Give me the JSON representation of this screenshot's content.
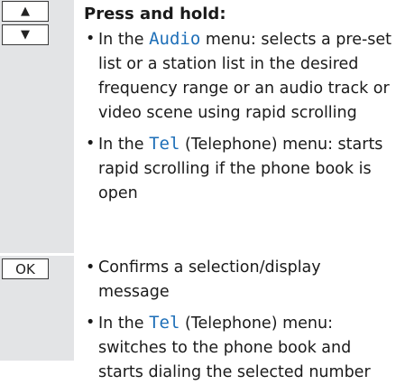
{
  "section1": {
    "keys": [
      {
        "icon": "triangle-up-icon",
        "glyph": "▲"
      },
      {
        "icon": "triangle-down-icon",
        "glyph": "▼"
      }
    ],
    "heading": "Press and hold:",
    "bullets": [
      {
        "pre": "In the ",
        "keyword": "Audio",
        "post": " menu: selects a pre-set list or a station list in the desired frequency range or an audio track or video scene using rapid scrolling"
      },
      {
        "pre": "In the ",
        "keyword": "Tel",
        "post": " (Telephone) menu: starts rapid scrolling if the phone book is open"
      }
    ]
  },
  "section2": {
    "key": {
      "icon": "ok-key-icon",
      "label": "OK"
    },
    "bullets": [
      {
        "text": "Confirms a selection/display message"
      },
      {
        "pre": "In the ",
        "keyword": "Tel",
        "post": " (Telephone) menu: switches to the phone book and starts dialing the selected number"
      }
    ]
  },
  "colors": {
    "key_column": "#e3e4e6",
    "keyword": "#1e6fb8"
  }
}
